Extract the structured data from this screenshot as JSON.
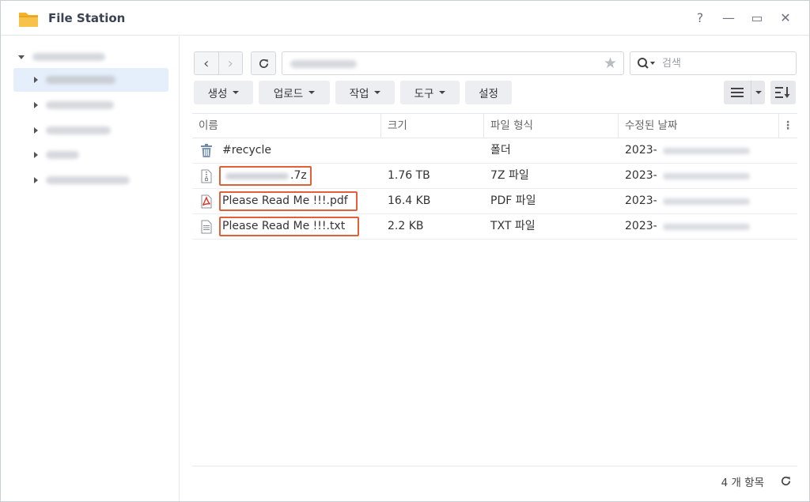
{
  "window": {
    "title": "File Station",
    "help": "?",
    "minimize": "—",
    "maximize": "▭",
    "close": "✕"
  },
  "sidebar": {
    "root_label": "",
    "items": [
      {
        "label": ""
      },
      {
        "label": ""
      },
      {
        "label": ""
      },
      {
        "label": ""
      },
      {
        "label": ""
      }
    ]
  },
  "toolbar": {
    "back": "‹",
    "forward": "›",
    "path": "",
    "search_placeholder": "검색",
    "create": "생성",
    "upload": "업로드",
    "action": "작업",
    "tools": "도구",
    "settings": "설정"
  },
  "table": {
    "columns": [
      "이름",
      "크기",
      "파일 형식",
      "수정된 날짜"
    ],
    "menu": "⋮",
    "rows": [
      {
        "icon": "recycle-bin-icon",
        "name": "#recycle",
        "size": "",
        "type": "폴더",
        "modified": "2023-"
      },
      {
        "icon": "archive-file-icon",
        "name": ".7z",
        "size": "1.76 TB",
        "type": "7Z 파일",
        "modified": "2023-"
      },
      {
        "icon": "pdf-file-icon",
        "name": "Please Read Me !!!.pdf",
        "size": "16.4 KB",
        "type": "PDF 파일",
        "modified": "2023-"
      },
      {
        "icon": "text-file-icon",
        "name": "Please Read Me !!!.txt",
        "size": "2.2 KB",
        "type": "TXT 파일",
        "modified": "2023-"
      }
    ]
  },
  "footer": {
    "count": "4 개 항목"
  },
  "colors": {
    "accent": "#e0603a",
    "selected": "#e5eefb",
    "folder": "#f5b32a"
  }
}
